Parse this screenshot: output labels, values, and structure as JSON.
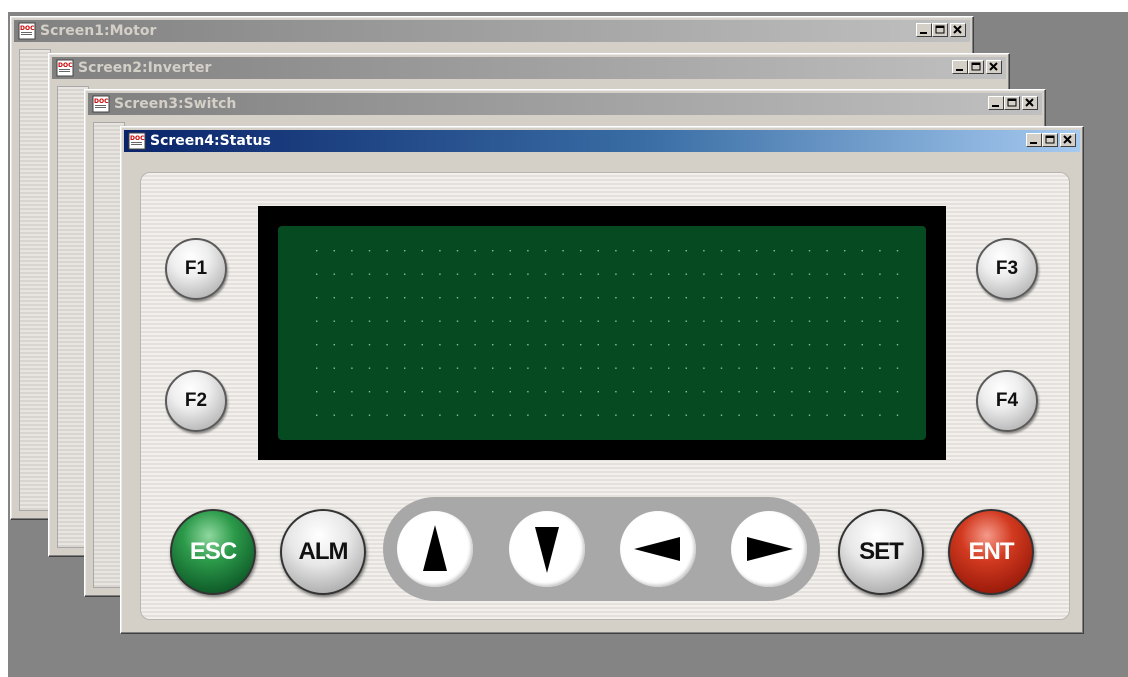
{
  "windows": [
    {
      "title": "Screen1:Motor"
    },
    {
      "title": "Screen2:Inverter"
    },
    {
      "title": "Screen3:Switch"
    },
    {
      "title": "Screen4:Status"
    }
  ],
  "window_controls": {
    "minimize_icon": "minimize-icon",
    "maximize_icon": "maximize-icon",
    "close_icon": "close-icon"
  },
  "app_icon": "document-icon",
  "panel": {
    "function_keys": [
      "F1",
      "F2",
      "F3",
      "F4"
    ],
    "bottom_keys": {
      "esc": "ESC",
      "alm": "ALM",
      "set": "SET",
      "ent": "ENT"
    },
    "arrow_keys": [
      "up-arrow-icon",
      "down-arrow-icon",
      "left-arrow-icon",
      "right-arrow-icon"
    ],
    "lcd_color": "#064a22",
    "esc_color": "#1f7a3a",
    "ent_color": "#c02a14"
  }
}
